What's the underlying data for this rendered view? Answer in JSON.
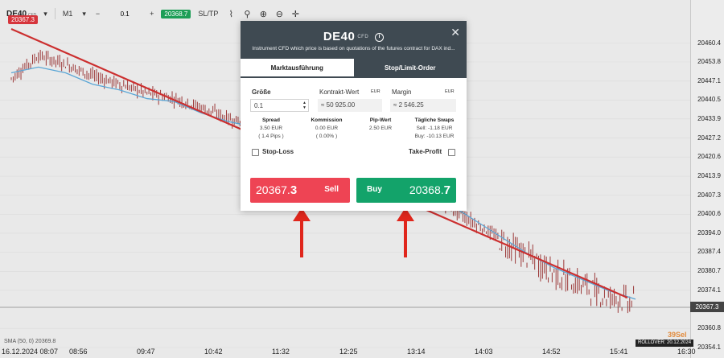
{
  "toolbar": {
    "symbol": "DE40",
    "symbol_type": "CFD",
    "timeframe": "M1",
    "quantity_minus": "−",
    "quantity": "0.1",
    "quantity_plus": "+",
    "sell_price": "20367.3",
    "buy_price": "20368.7",
    "sltp": "SL/TP",
    "icons": [
      "line-chart-icon",
      "indicator-icon",
      "zoom-in-icon",
      "zoom-out-icon",
      "crosshair-icon"
    ]
  },
  "chart_data": {
    "type": "line",
    "series": [
      {
        "values": [
          20448,
          20456,
          20453,
          20449,
          20446,
          20443,
          20441,
          20438,
          20434,
          20432,
          20430,
          20426,
          20422,
          20418,
          20414,
          20410,
          20404,
          20398,
          20392,
          20386,
          20380,
          20376,
          20372,
          20370
        ]
      },
      {
        "values": [
          20450,
          20452,
          20450,
          20446,
          20444,
          20441,
          20440,
          20436,
          20433,
          20431,
          20429,
          20425,
          20422,
          20418,
          20414,
          20410,
          20405,
          20399,
          20393,
          20387,
          20382,
          20378,
          20374,
          20371
        ]
      }
    ],
    "ylim": [
      20354.1,
      20467
    ],
    "y_ticks": [
      "20460.4",
      "20453.8",
      "20447.1",
      "20440.5",
      "20433.9",
      "20427.2",
      "20420.6",
      "20413.9",
      "20407.3",
      "20400.6",
      "20394.0",
      "20387.4",
      "20380.7",
      "20374.1",
      "20360.8",
      "20354.1"
    ],
    "current_price": "20367.3",
    "x_ticks": [
      "16.12.2024 08:07",
      "08:56",
      "09:47",
      "10:42",
      "11:32",
      "12:25",
      "13:14",
      "14:03",
      "14:52",
      "15:41",
      "16:30"
    ],
    "sma_label": "SMA (50, 0)  20369.8",
    "rollover": "ROLLOVER: 20.12.2024",
    "watermark": "39Sel",
    "colors": {
      "trendline": "#cc2f2f",
      "sma": "#5aa6d6",
      "candle": "#9c3a3a"
    }
  },
  "modal": {
    "title": "DE40",
    "title_tag": "CFD",
    "description": "Instrument CFD which price is based on quotations of the futures contract for DAX ind...",
    "tabs": [
      "Marktausführung",
      "Stop/Limit-Order"
    ],
    "size_label": "Größe",
    "size_value": "0.1",
    "contract_label": "Kontrakt-Wert",
    "contract_currency": "EUR",
    "contract_value": "≈ 50 925.00",
    "margin_label": "Margin",
    "margin_currency": "EUR",
    "margin_value": "≈ 2 546.25",
    "stats": {
      "spread_title": "Spread",
      "spread_line1": "3.50 EUR",
      "spread_line2": "( 1.4 Pips )",
      "commission_title": "Kommission",
      "commission_line1": "0.00 EUR",
      "commission_line2": "( 0.00% )",
      "pip_title": "Pip-Wert",
      "pip_line1": "2.50 EUR",
      "swap_title": "Tägliche Swaps",
      "swap_line1": "Sell: -1.18 EUR",
      "swap_line2": "Buy: -10.13 EUR"
    },
    "stop_loss_label": "Stop-Loss",
    "take_profit_label": "Take-Profit",
    "sell": {
      "label": "Sell",
      "price_main": "20367.",
      "price_big": "3"
    },
    "buy": {
      "label": "Buy",
      "price_main": "20368.",
      "price_big": "7"
    },
    "accent_colors": {
      "sell": "#ee4454",
      "buy": "#13a36a",
      "header": "#3f4a52"
    }
  }
}
